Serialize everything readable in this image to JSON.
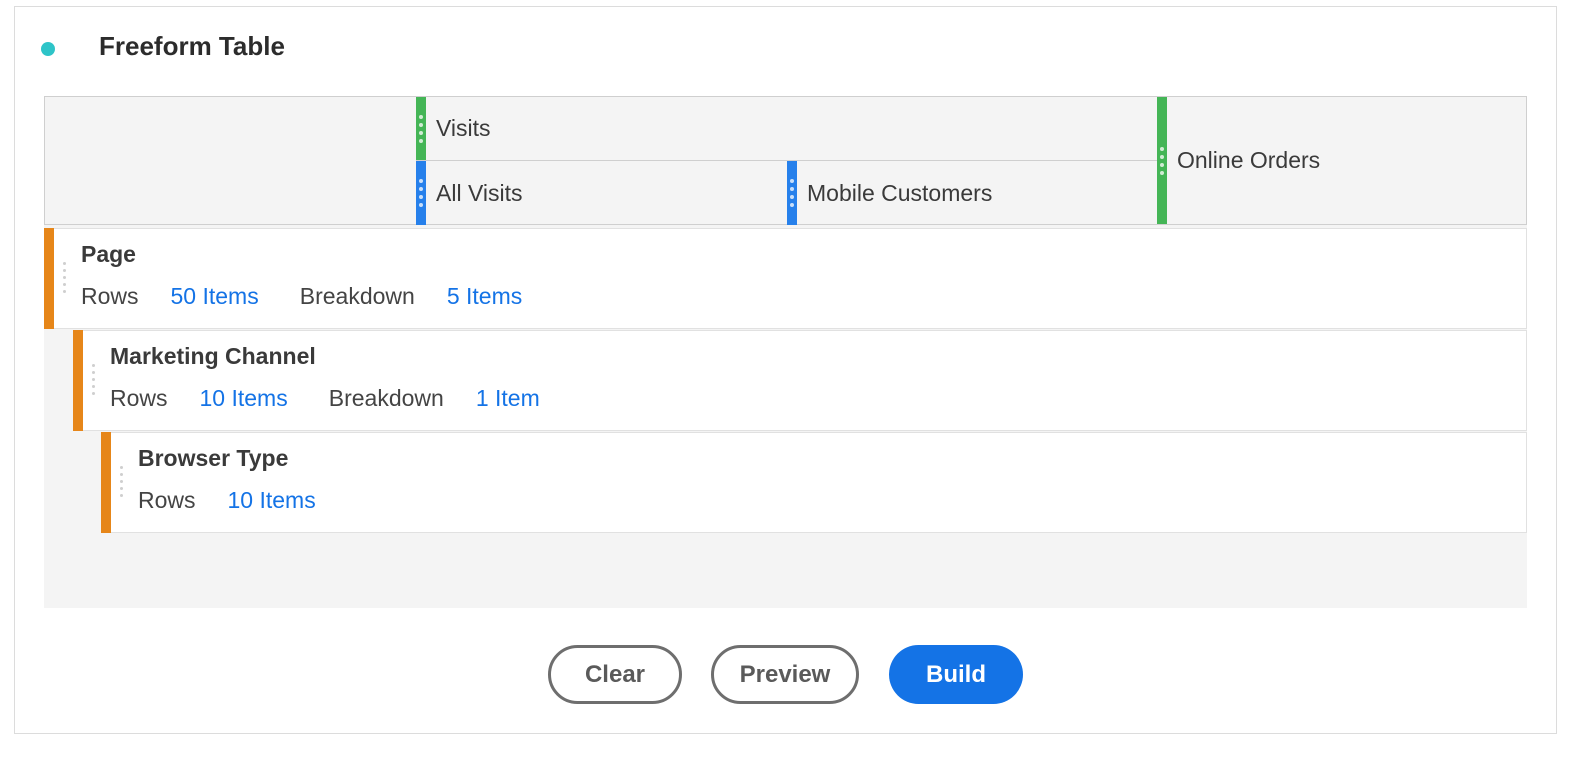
{
  "panel": {
    "title": "Freeform Table",
    "status_color": "#2ec4c8",
    "icon": "status-dot-icon"
  },
  "columns": {
    "metric_group": {
      "label": "Visits",
      "color": "#44b556"
    },
    "segments": [
      {
        "label": "All Visits",
        "color": "#2680eb"
      },
      {
        "label": "Mobile Customers",
        "color": "#2680eb"
      }
    ],
    "metric_single": {
      "label": "Online Orders",
      "color": "#44b556"
    }
  },
  "rows": [
    {
      "title": "Page",
      "rows_label": "Rows",
      "rows_value": "50 Items",
      "breakdown_label": "Breakdown",
      "breakdown_value": "5 Items"
    },
    {
      "title": "Marketing Channel",
      "rows_label": "Rows",
      "rows_value": "10 Items",
      "breakdown_label": "Breakdown",
      "breakdown_value": "1 Item"
    },
    {
      "title": "Browser Type",
      "rows_label": "Rows",
      "rows_value": "10 Items"
    }
  ],
  "dimension_color": "#e68619",
  "link_color": "#1473e6",
  "actions": {
    "clear": "Clear",
    "preview": "Preview",
    "build": "Build",
    "primary_color": "#1473e6"
  }
}
